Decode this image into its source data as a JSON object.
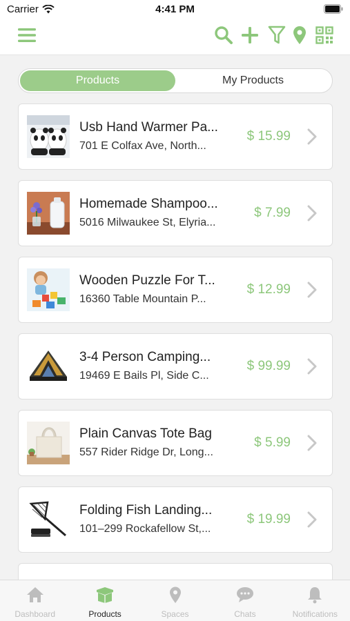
{
  "status": {
    "carrier": "Carrier",
    "time": "4:41 PM"
  },
  "toolbar": {
    "icons": [
      "menu-icon",
      "search-icon",
      "add-icon",
      "filter-icon",
      "location-pin-icon",
      "qr-code-icon"
    ],
    "accent_color": "#8dc77b"
  },
  "segments": {
    "products": "Products",
    "my_products": "My Products"
  },
  "products": [
    {
      "title": "Usb Hand Warmer Pa...",
      "address": "701 E Colfax Ave, North...",
      "price": "$ 15.99",
      "image": "panda-hand-warmer-image"
    },
    {
      "title": "Homemade Shampoo...",
      "address": "5016 Milwaukee St, Elyria...",
      "price": "$ 7.99",
      "image": "shampoo-bottle-image"
    },
    {
      "title": "Wooden Puzzle For T...",
      "address": "16360 Table Mountain P...",
      "price": "$ 12.99",
      "image": "child-puzzle-image"
    },
    {
      "title": "3-4 Person Camping...",
      "address": "19469 E Bails Pl, Side C...",
      "price": "$ 99.99",
      "image": "tent-image"
    },
    {
      "title": "Plain Canvas Tote Bag",
      "address": "557 Rider Ridge Dr, Long...",
      "price": "$ 5.99",
      "image": "tote-bag-image"
    },
    {
      "title": "Folding Fish Landing...",
      "address": "101–299 Rockafellow St,...",
      "price": "$ 19.99",
      "image": "fish-net-image"
    }
  ],
  "tabs": [
    {
      "label": "Dashboard",
      "icon": "home-icon",
      "active": false
    },
    {
      "label": "Products",
      "icon": "box-icon",
      "active": true
    },
    {
      "label": "Spaces",
      "icon": "location-pin-icon",
      "active": false
    },
    {
      "label": "Chats",
      "icon": "chat-bubble-icon",
      "active": false
    },
    {
      "label": "Notifications",
      "icon": "bell-icon",
      "active": false
    }
  ]
}
